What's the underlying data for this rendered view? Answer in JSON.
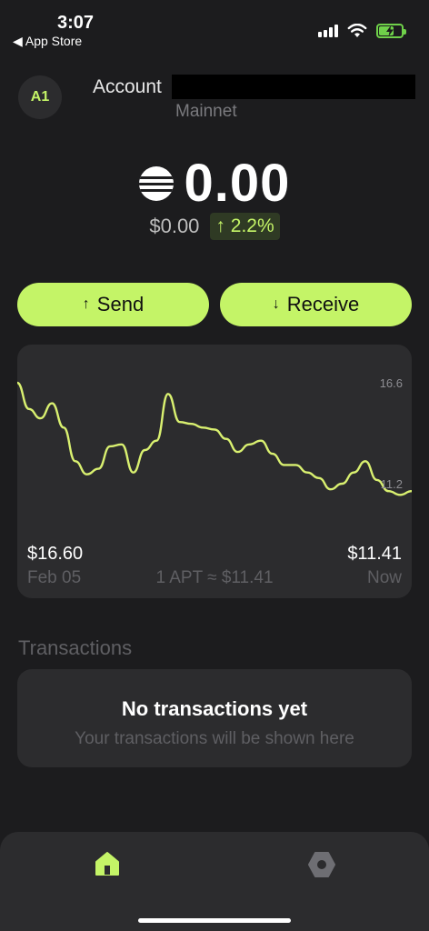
{
  "status_bar": {
    "time": "3:07",
    "back_app": "◀ App Store"
  },
  "header": {
    "avatar": "A1",
    "account_label": "Account",
    "network": "Mainnet"
  },
  "balance": {
    "amount": "0.00",
    "fiat": "$0.00",
    "change": "2.2%",
    "change_arrow": "↑",
    "change_color": "#c4f467"
  },
  "actions": {
    "send_label": "Send",
    "send_arrow": "↑",
    "receive_label": "Receive",
    "receive_arrow": "↓",
    "accent": "#c4f467"
  },
  "chart_data": {
    "type": "line",
    "y_ticks": [
      "16.6",
      "11.2"
    ],
    "ylim": [
      11.2,
      16.6
    ],
    "series": [
      {
        "values": [
          16.6,
          15.2,
          14.7,
          15.5,
          14.2,
          12.4,
          11.7,
          12.0,
          13.2,
          13.3,
          11.8,
          13.0,
          13.5,
          16.0,
          14.5,
          14.4,
          14.2,
          14.1,
          13.6,
          12.9,
          13.3,
          13.5,
          12.8,
          12.2,
          12.2,
          11.8,
          11.5,
          10.9,
          11.2,
          11.8,
          12.4,
          11.4,
          10.8,
          10.6,
          10.8
        ]
      }
    ],
    "line_color": "#d9f070",
    "start_price": "$16.60",
    "end_price": "$11.41",
    "start_date": "Feb 05",
    "end_date": "Now",
    "rate": "1 APT ≈ $11.41"
  },
  "transactions": {
    "title": "Transactions",
    "empty_title": "No transactions yet",
    "empty_subtitle": "Your transactions will be shown here"
  },
  "tab_bar": {
    "home_icon": "home-icon",
    "settings_icon": "settings-icon"
  }
}
